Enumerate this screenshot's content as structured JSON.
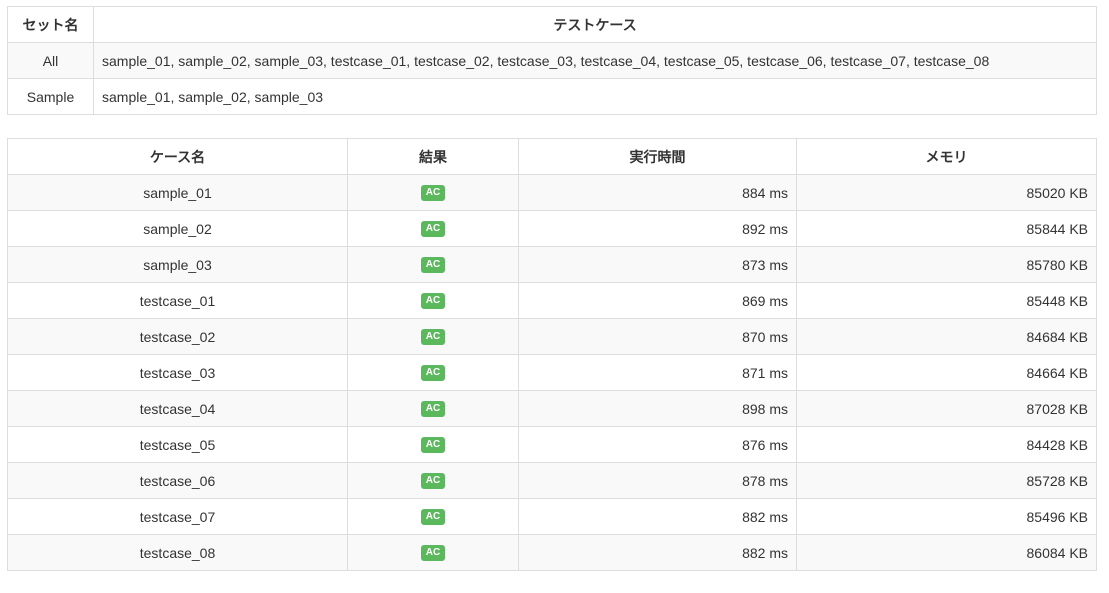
{
  "sets": {
    "headers": [
      "セット名",
      "テストケース"
    ],
    "rows": [
      {
        "name": "All",
        "cases": "sample_01, sample_02, sample_03, testcase_01, testcase_02, testcase_03, testcase_04, testcase_05, testcase_06, testcase_07, testcase_08"
      },
      {
        "name": "Sample",
        "cases": "sample_01, sample_02, sample_03"
      }
    ]
  },
  "results": {
    "headers": [
      "ケース名",
      "結果",
      "実行時間",
      "メモリ"
    ],
    "badge_color": "#5cb85c",
    "rows": [
      {
        "name": "sample_01",
        "status": "AC",
        "time": "884 ms",
        "memory": "85020 KB"
      },
      {
        "name": "sample_02",
        "status": "AC",
        "time": "892 ms",
        "memory": "85844 KB"
      },
      {
        "name": "sample_03",
        "status": "AC",
        "time": "873 ms",
        "memory": "85780 KB"
      },
      {
        "name": "testcase_01",
        "status": "AC",
        "time": "869 ms",
        "memory": "85448 KB"
      },
      {
        "name": "testcase_02",
        "status": "AC",
        "time": "870 ms",
        "memory": "84684 KB"
      },
      {
        "name": "testcase_03",
        "status": "AC",
        "time": "871 ms",
        "memory": "84664 KB"
      },
      {
        "name": "testcase_04",
        "status": "AC",
        "time": "898 ms",
        "memory": "87028 KB"
      },
      {
        "name": "testcase_05",
        "status": "AC",
        "time": "876 ms",
        "memory": "84428 KB"
      },
      {
        "name": "testcase_06",
        "status": "AC",
        "time": "878 ms",
        "memory": "85728 KB"
      },
      {
        "name": "testcase_07",
        "status": "AC",
        "time": "882 ms",
        "memory": "85496 KB"
      },
      {
        "name": "testcase_08",
        "status": "AC",
        "time": "882 ms",
        "memory": "86084 KB"
      }
    ]
  }
}
